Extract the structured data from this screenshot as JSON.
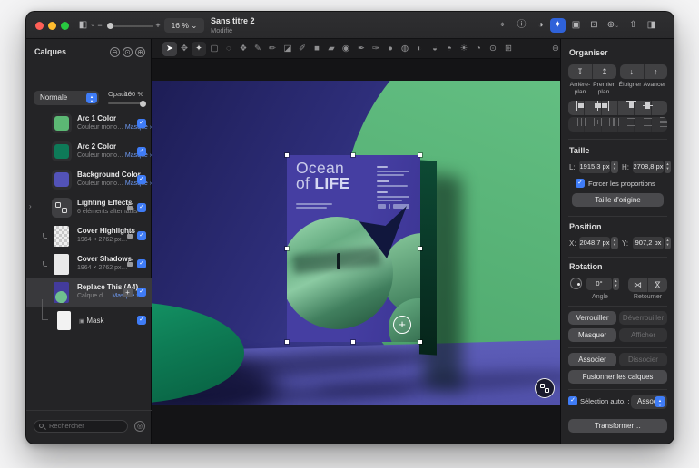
{
  "window": {
    "title": "Sans titre 2",
    "status": "Modifié",
    "zoom_level": "16 %"
  },
  "colors": {
    "accent": "#3f7cf6",
    "canvas_green": "#5cb878",
    "canvas_purple": "#2e2e7a",
    "pedestal_green": "#0f8159",
    "poster_purple": "#443da0"
  },
  "icons": {
    "sidebar_toggle": "◧",
    "chevron_down": "⌄",
    "zoom_out": "−",
    "zoom_in": "+",
    "vector": "⌖",
    "info": "ⓘ",
    "adjust": "◑",
    "effects": "✦",
    "photo": "▣",
    "crop": "⊡",
    "more": "⊕",
    "share": "⇧",
    "panel": "◨",
    "collapse": "⊖",
    "settings": "⊙",
    "add": "⊕",
    "remove_tool": "⊖",
    "filter": "◎",
    "disclosure": "›",
    "flip_h": "⋈",
    "flip_v": "⋈",
    "to_back": "↧",
    "to_front": "↥",
    "backward": "↓",
    "forward": "↑",
    "mask_glyph": "▣",
    "plus_small": "+"
  },
  "tools": [
    {
      "name": "arrange",
      "glyph": "➤"
    },
    {
      "name": "move",
      "glyph": "✥"
    },
    {
      "name": "select",
      "glyph": "✦"
    },
    {
      "name": "rect-select",
      "glyph": "▢"
    },
    {
      "name": "free-select",
      "glyph": "◌"
    },
    {
      "name": "quick-select",
      "glyph": "❖"
    },
    {
      "name": "paint",
      "glyph": "✎"
    },
    {
      "name": "pixel-paint",
      "glyph": "✏"
    },
    {
      "name": "erase",
      "glyph": "◪"
    },
    {
      "name": "pixel-pen",
      "glyph": "✐"
    },
    {
      "name": "shape",
      "glyph": "■"
    },
    {
      "name": "gradient",
      "glyph": "▰"
    },
    {
      "name": "fill",
      "glyph": "◉"
    },
    {
      "name": "pen",
      "glyph": "✒"
    },
    {
      "name": "freeform-pen",
      "glyph": "✑"
    },
    {
      "name": "repair",
      "glyph": "●"
    },
    {
      "name": "clone",
      "glyph": "◍"
    },
    {
      "name": "blur",
      "glyph": "◐"
    },
    {
      "name": "sharpen",
      "glyph": "◒"
    },
    {
      "name": "desaturate",
      "glyph": "◓"
    },
    {
      "name": "lighten",
      "glyph": "☀"
    },
    {
      "name": "smudge",
      "glyph": "◔"
    },
    {
      "name": "zoom",
      "glyph": "⊙"
    },
    {
      "name": "crop",
      "glyph": "⊞"
    }
  ],
  "layers_panel": {
    "title": "Calques",
    "blend_mode": "Normale",
    "opacity_label": "Opacité",
    "opacity_value": "100 %",
    "search_placeholder": "Rechercher",
    "layers": [
      {
        "name": "Arc 1 Color",
        "subtitle": "Couleur mono…",
        "mask": "Masque ›",
        "swatch": "#5cb874"
      },
      {
        "name": "Arc 2 Color",
        "subtitle": "Couleur mono…",
        "mask": "Masque ›",
        "swatch": "#0e7a58"
      },
      {
        "name": "Background Color",
        "subtitle": "Couleur mono…",
        "mask": "Masque ›",
        "swatch": "#5353b8"
      },
      {
        "name": "Lighting Effects",
        "subtitle": "6 éléments alternatifs"
      },
      {
        "name": "Cover Highlights",
        "subtitle": "1964 × 2762 px…"
      },
      {
        "name": "Cover Shadows",
        "subtitle": "1964 × 2762 px…"
      },
      {
        "name": "Replace This (A4)",
        "subtitle": "Calque d'…",
        "mask": "Masque ›"
      },
      {
        "name": "Mask"
      }
    ]
  },
  "canvas": {
    "poster_word1": "Ocean",
    "poster_word2": "of",
    "poster_word3": "LIFE",
    "add_button": "+"
  },
  "organize": {
    "title": "Organiser",
    "back_label": "Arrière-plan",
    "front_label": "Premier plan",
    "backward_label": "Éloigner",
    "forward_label": "Avancer"
  },
  "size": {
    "title": "Taille",
    "w_label": "L:",
    "w_value": "1915,3 px",
    "h_label": "H:",
    "h_value": "2708,8 px",
    "constrain_label": "Forcer les proportions",
    "original_label": "Taille d'origine"
  },
  "position": {
    "title": "Position",
    "x_label": "X:",
    "x_value": "2048,7 px",
    "y_label": "Y:",
    "y_value": "907,2 px"
  },
  "rotation": {
    "title": "Rotation",
    "angle_value": "0°",
    "angle_caption": "Angle",
    "flip_caption": "Retourner"
  },
  "actions": {
    "lock": "Verrouiller",
    "unlock": "Déverrouiller",
    "hide": "Masquer",
    "show": "Afficher",
    "group": "Associer",
    "ungroup": "Dissocier",
    "merge": "Fusionner les calques",
    "transform": "Transformer…"
  },
  "auto_select": {
    "label": "Sélection auto. :",
    "value": "Associer"
  }
}
